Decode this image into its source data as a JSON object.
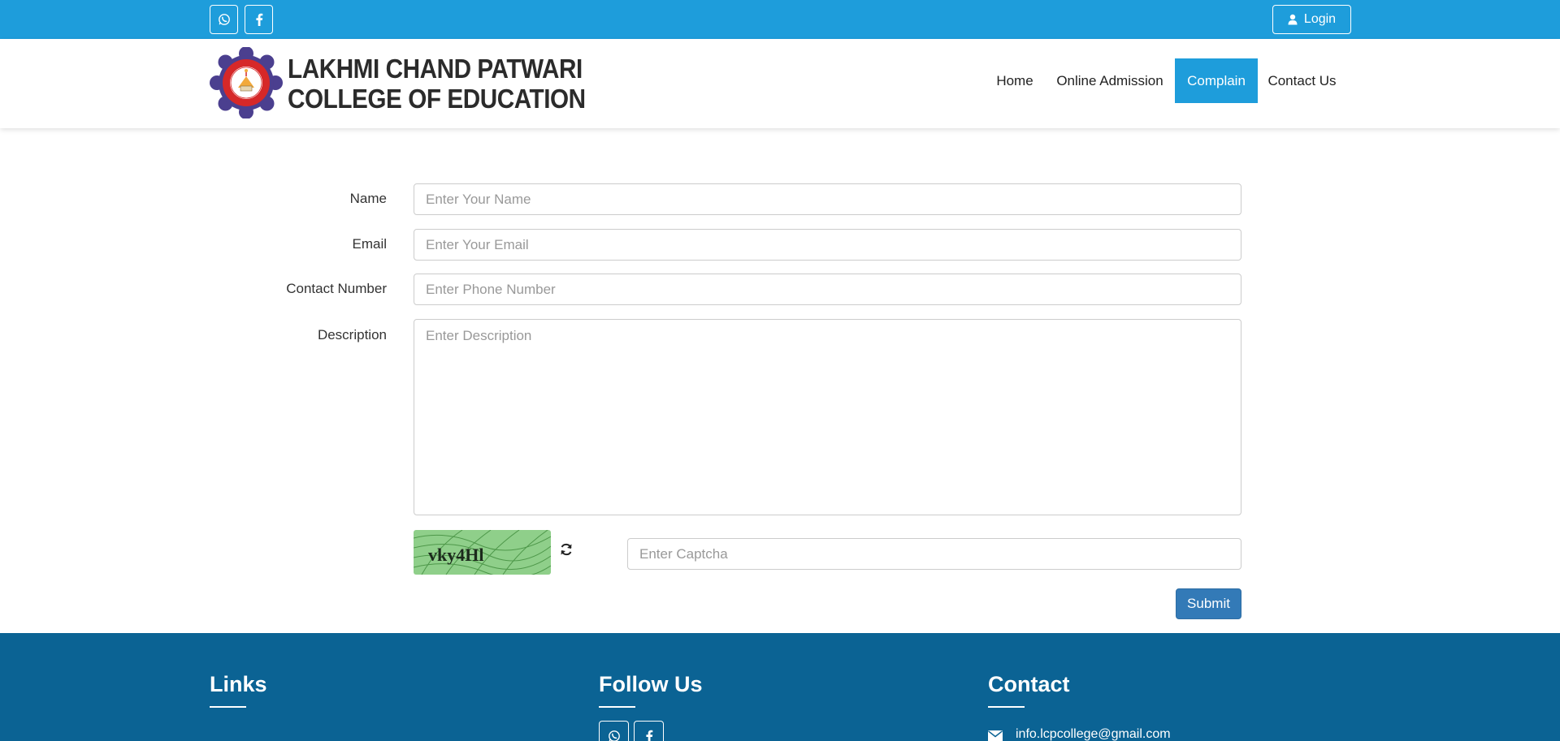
{
  "topbar": {
    "social": [
      {
        "icon": "whatsapp-icon"
      },
      {
        "icon": "facebook-icon"
      }
    ],
    "login_label": "Login"
  },
  "header": {
    "logo_line1": "LAKHMI CHAND PATWARI",
    "logo_line2": "COLLEGE OF EDUCATION",
    "nav": [
      {
        "label": "Home"
      },
      {
        "label": "Online Admission"
      },
      {
        "label": "Complain"
      },
      {
        "label": "Contact Us"
      }
    ],
    "active_nav": "Complain"
  },
  "form": {
    "name_label": "Name",
    "name_placeholder": "Enter Your Name",
    "email_label": "Email",
    "email_placeholder": "Enter Your Email",
    "contact_label": "Contact Number",
    "contact_placeholder": "Enter Phone Number",
    "description_label": "Description",
    "description_placeholder": "Enter Description",
    "captcha_text": "vky4Hl",
    "captcha_placeholder": "Enter Captcha",
    "submit_label": "Submit"
  },
  "footer": {
    "links_title": "Links",
    "follow_title": "Follow Us",
    "contact_title": "Contact",
    "email": "info.lcpcollege@gmail.com"
  },
  "colors": {
    "topbar": "#1e9ddb",
    "active_nav": "#1e9ddb",
    "submit": "#337ab7",
    "footer": "#0b6394"
  }
}
